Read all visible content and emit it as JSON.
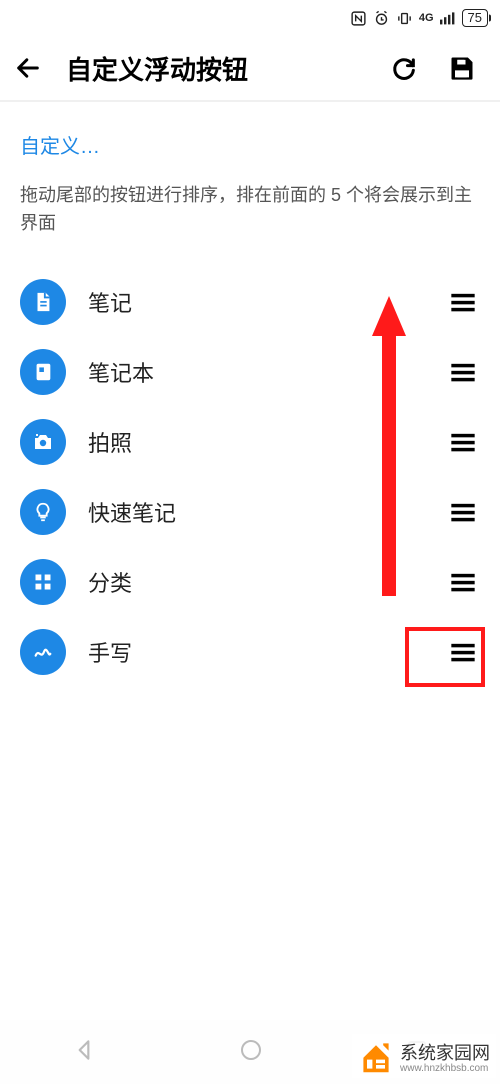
{
  "status": {
    "battery": "75"
  },
  "header": {
    "title": "自定义浮动按钮"
  },
  "section": {
    "link": "自定义…",
    "desc": "拖动尾部的按钮进行排序，排在前面的 5 个将会展示到主界面"
  },
  "items": [
    {
      "label": "笔记"
    },
    {
      "label": "笔记本"
    },
    {
      "label": "拍照"
    },
    {
      "label": "快速笔记"
    },
    {
      "label": "分类"
    },
    {
      "label": "手写"
    }
  ],
  "watermark": {
    "line1": "系统家园网",
    "line2": "www.hnzkhbsb.com"
  }
}
